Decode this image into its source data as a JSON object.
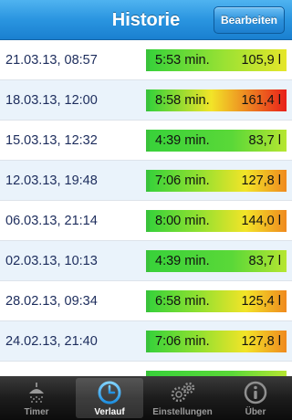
{
  "navbar": {
    "title": "Historie",
    "edit_label": "Bearbeiten"
  },
  "history": [
    {
      "date": "21.03.13, 08:57",
      "duration": "5:53 min.",
      "volume": "105,9 l",
      "level": 0.55
    },
    {
      "date": "18.03.13, 12:00",
      "duration": "8:58 min.",
      "volume": "161,4 l",
      "level": 1.0
    },
    {
      "date": "15.03.13, 12:32",
      "duration": "4:39 min.",
      "volume": "83,7 l",
      "level": 0.3
    },
    {
      "date": "12.03.13, 19:48",
      "duration": "7:06 min.",
      "volume": "127,8 l",
      "level": 0.8
    },
    {
      "date": "06.03.13, 21:14",
      "duration": "8:00 min.",
      "volume": "144,0 l",
      "level": 0.9
    },
    {
      "date": "02.03.13, 10:13",
      "duration": "4:39 min.",
      "volume": "83,7 l",
      "level": 0.3
    },
    {
      "date": "28.02.13, 09:34",
      "duration": "6:58 min.",
      "volume": "125,4 l",
      "level": 0.8
    },
    {
      "date": "24.02.13, 21:40",
      "duration": "7:06 min.",
      "volume": "127,8 l",
      "level": 0.8
    },
    {
      "date": "",
      "duration": "",
      "volume": "",
      "level": 0.4
    }
  ],
  "tabs": [
    {
      "label": "Timer",
      "icon": "shower-icon",
      "active": false
    },
    {
      "label": "Verlauf",
      "icon": "clock-icon",
      "active": true
    },
    {
      "label": "Einstellungen",
      "icon": "gears-icon",
      "active": false
    },
    {
      "label": "Über",
      "icon": "info-icon",
      "active": false
    }
  ],
  "colors": {
    "nav": "#2a95e0",
    "bar_green": "#39d23a",
    "bar_yellow": "#f2e428",
    "bar_red": "#e8201a"
  }
}
